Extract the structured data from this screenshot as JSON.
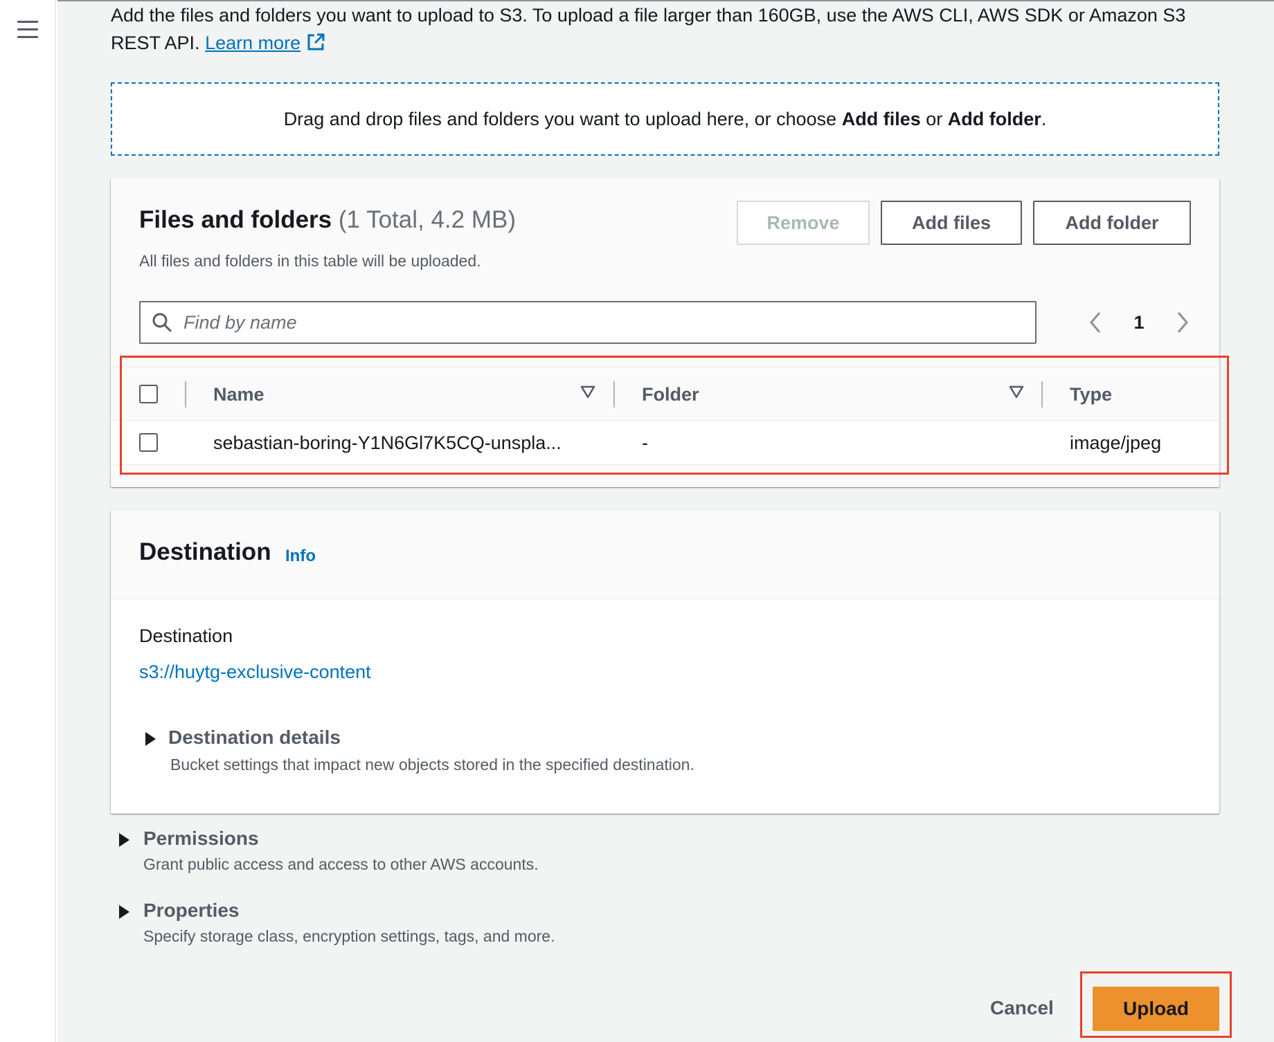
{
  "intro": {
    "text": "Add the files and folders you want to upload to S3. To upload a file larger than 160GB, use the AWS CLI, AWS SDK or Amazon S3 REST API.",
    "learn_more": "Learn more"
  },
  "dropzone": {
    "prefix": "Drag and drop files and folders you want to upload here, or choose",
    "add_files": "Add files",
    "or": "or",
    "add_folder": "Add folder",
    "suffix": "."
  },
  "files_panel": {
    "title": "Files and folders",
    "count": "(1 Total, 4.2 MB)",
    "description": "All files and folders in this table will be uploaded.",
    "remove_label": "Remove",
    "add_files_label": "Add files",
    "add_folder_label": "Add folder",
    "search_placeholder": "Find by name",
    "page_number": "1",
    "columns": [
      "Name",
      "Folder",
      "Type"
    ],
    "rows": [
      {
        "name": "sebastian-boring-Y1N6Gl7K5CQ-unspla...",
        "folder": "-",
        "type": "image/jpeg"
      }
    ]
  },
  "destination_panel": {
    "title": "Destination",
    "info": "Info",
    "label": "Destination",
    "value": "s3://huytg-exclusive-content",
    "details_title": "Destination details",
    "details_desc": "Bucket settings that impact new objects stored in the specified destination."
  },
  "permissions": {
    "title": "Permissions",
    "desc": "Grant public access and access to other AWS accounts."
  },
  "properties": {
    "title": "Properties",
    "desc": "Specify storage class, encryption settings, tags, and more."
  },
  "footer": {
    "cancel_label": "Cancel",
    "upload_label": "Upload"
  },
  "colors": {
    "link": "#0073bb",
    "upload_button": "#ec912d",
    "highlight": "#e8412c"
  }
}
